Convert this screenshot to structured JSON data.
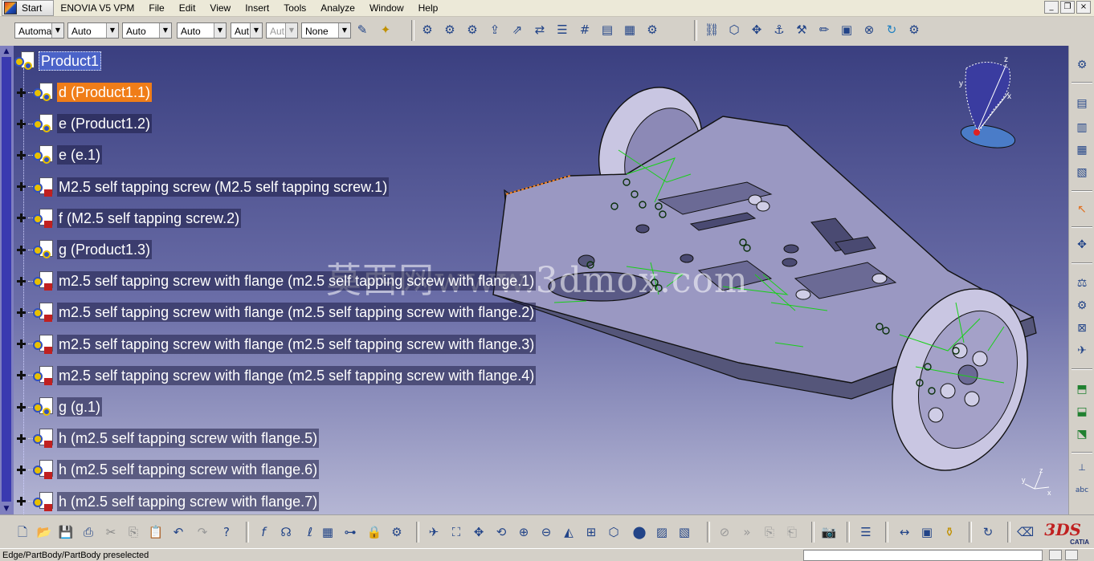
{
  "menubar": {
    "start": "Start",
    "items": [
      "ENOVIA V5 VPM",
      "File",
      "Edit",
      "View",
      "Insert",
      "Tools",
      "Analyze",
      "Window",
      "Help"
    ]
  },
  "window_buttons": {
    "minimize": "_",
    "restore": "❐",
    "close": "×"
  },
  "toolbar": {
    "combos": [
      {
        "value": "Automa",
        "disabled": false
      },
      {
        "value": "Auto",
        "disabled": false
      },
      {
        "value": "Auto",
        "disabled": false
      },
      {
        "value": "Auto",
        "disabled": false
      },
      {
        "value": "Aut",
        "disabled": false
      },
      {
        "value": "Aut",
        "disabled": true
      },
      {
        "value": "None",
        "disabled": false
      }
    ],
    "dropdown_glyph": "▼"
  },
  "tree": {
    "root": "Product1",
    "nodes": [
      {
        "label": "d (Product1.1)",
        "state": "selected",
        "type": "product"
      },
      {
        "label": "e (Product1.2)",
        "state": "normal",
        "type": "product"
      },
      {
        "label": "e (e.1)",
        "state": "normal",
        "type": "product"
      },
      {
        "label": "M2.5  self tapping screw (M2.5  self tapping screw.1)",
        "state": "normal",
        "type": "part"
      },
      {
        "label": "f (M2.5  self tapping screw.2)",
        "state": "normal",
        "type": "part"
      },
      {
        "label": "g (Product1.3)",
        "state": "normal",
        "type": "product"
      },
      {
        "label": "m2.5 self tapping screw with flange (m2.5 self tapping screw with flange.1)",
        "state": "normal",
        "type": "part"
      },
      {
        "label": "m2.5 self tapping screw with flange (m2.5 self tapping screw with flange.2)",
        "state": "normal",
        "type": "part"
      },
      {
        "label": "m2.5 self tapping screw with flange (m2.5 self tapping screw with flange.3)",
        "state": "normal",
        "type": "part"
      },
      {
        "label": "m2.5 self tapping screw with flange (m2.5 self tapping screw with flange.4)",
        "state": "normal",
        "type": "part"
      },
      {
        "label": "g (g.1)",
        "state": "normal",
        "type": "product"
      },
      {
        "label": "h (m2.5 self tapping screw with flange.5)",
        "state": "normal",
        "type": "part"
      },
      {
        "label": "h (m2.5 self tapping screw with flange.6)",
        "state": "normal",
        "type": "part"
      },
      {
        "label": "h (m2.5 self tapping screw with flange.7)",
        "state": "normal",
        "type": "part"
      }
    ]
  },
  "watermark": "莫西网www.3dmox.com",
  "compass": {
    "x": "x",
    "y": "y",
    "z": "z"
  },
  "mini_axis": {
    "x": "x",
    "y": "y",
    "z": "z"
  },
  "catia_logo": {
    "brand": "CATIA",
    "mark": "3DS"
  },
  "status": {
    "text": "Edge/PartBody/PartBody preselected"
  },
  "colors": {
    "selected_highlight": "#f07d18",
    "root_highlight": "#4b63c8",
    "viewport_top": "#3a3f80",
    "viewport_bottom": "#b5b6d4"
  }
}
